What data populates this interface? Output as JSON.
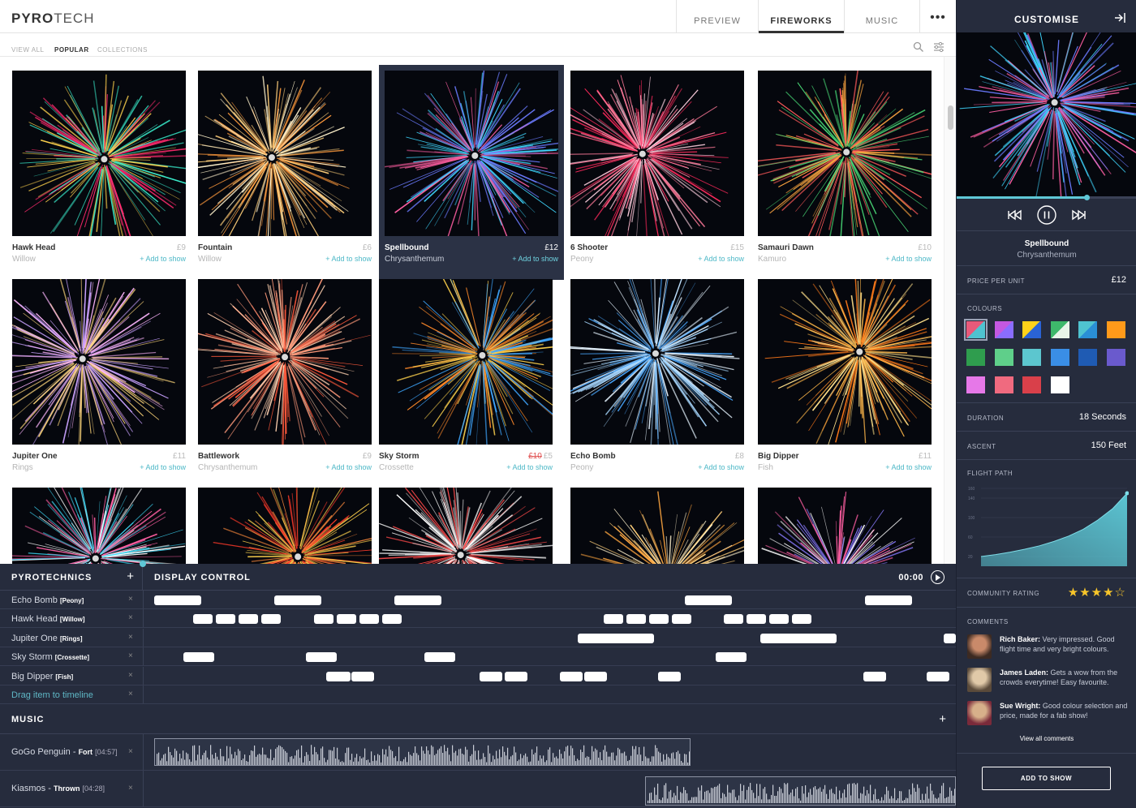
{
  "brand": {
    "bold": "PYRO",
    "light": "TECH"
  },
  "nav": {
    "tabs": [
      {
        "label": "PREVIEW",
        "active": false
      },
      {
        "label": "FIREWORKS",
        "active": true
      },
      {
        "label": "MUSIC",
        "active": false
      }
    ],
    "more_icon": "more-horizontal-icon"
  },
  "subnav": {
    "items": [
      {
        "label": "VIEW ALL",
        "active": false
      },
      {
        "label": "POPULAR",
        "active": true
      },
      {
        "label": "COLLECTIONS",
        "active": false
      }
    ],
    "icons": [
      "search-icon",
      "filter-icon"
    ]
  },
  "fireworks": [
    {
      "name": "Hawk Head",
      "type": "Willow",
      "price": "£9",
      "old_price": "",
      "add": "+ Add to show",
      "colors": [
        "#ff2a6d",
        "#38e8c8",
        "#ffd34d"
      ],
      "selected": false
    },
    {
      "name": "Fountain",
      "type": "Willow",
      "price": "£6",
      "old_price": "",
      "add": "+ Add to show",
      "colors": [
        "#ffcf7a",
        "#fff2cc",
        "#ff9a3c"
      ],
      "selected": false
    },
    {
      "name": "Spellbound",
      "type": "Chrysanthemum",
      "price": "£12",
      "old_price": "",
      "add": "+ Add to show",
      "colors": [
        "#3fd7ff",
        "#ff5fa2",
        "#6b7bff"
      ],
      "selected": true
    },
    {
      "name": "6 Shooter",
      "type": "Peony",
      "price": "£15",
      "old_price": "",
      "add": "+ Add to show",
      "colors": [
        "#ff2a5c",
        "#ff7a9a",
        "#ffd0e0"
      ],
      "selected": false
    },
    {
      "name": "Samauri Dawn",
      "type": "Kamuro",
      "price": "£10",
      "old_price": "",
      "add": "+ Add to show",
      "colors": [
        "#4be07a",
        "#ff5a5a",
        "#ffa640"
      ],
      "selected": false
    },
    {
      "name": "Jupiter One",
      "type": "Rings",
      "price": "£11",
      "old_price": "",
      "add": "+ Add to show",
      "colors": [
        "#ffb6ff",
        "#ffd77a",
        "#c9a2ff"
      ],
      "selected": false
    },
    {
      "name": "Battlework",
      "type": "Chrysanthemum",
      "price": "£9",
      "old_price": "",
      "add": "+ Add to show",
      "colors": [
        "#ff5a3c",
        "#ff9a7a",
        "#ffd1b0"
      ],
      "selected": false
    },
    {
      "name": "Sky Storm",
      "type": "Crossette",
      "price": "£5",
      "old_price": "£10",
      "add": "+ Add to show",
      "colors": [
        "#ff8a2a",
        "#ffd34d",
        "#3fa7ff"
      ],
      "selected": false
    },
    {
      "name": "Echo Bomb",
      "type": "Peony",
      "price": "£8",
      "old_price": "",
      "add": "+ Add to show",
      "colors": [
        "#4aa8ff",
        "#a8d8ff",
        "#e6f4ff"
      ],
      "selected": false
    },
    {
      "name": "Big Dipper",
      "type": "Fish",
      "price": "£11",
      "old_price": "",
      "add": "+ Add to show",
      "colors": [
        "#ff7a1a",
        "#ffb84a",
        "#ffe08a"
      ],
      "selected": false
    },
    {
      "name": "",
      "type": "",
      "price": "",
      "old_price": "",
      "add": "",
      "colors": [
        "#3fe0ff",
        "#ff5fa2",
        "#ffffff"
      ],
      "selected": false
    },
    {
      "name": "",
      "type": "",
      "price": "",
      "old_price": "",
      "add": "",
      "colors": [
        "#ff3a2a",
        "#ffd34d",
        "#ff8a3c"
      ],
      "selected": false
    },
    {
      "name": "",
      "type": "",
      "price": "",
      "old_price": "",
      "add": "",
      "colors": [
        "#ffffff",
        "#dcdcdc",
        "#ff4a4a"
      ],
      "selected": false
    },
    {
      "name": "",
      "type": "",
      "price": "",
      "old_price": "",
      "add": "",
      "colors": [
        "#ffcf7a",
        "#fff2cc",
        "#ffa640"
      ],
      "selected": false
    },
    {
      "name": "",
      "type": "",
      "price": "",
      "old_price": "",
      "add": "",
      "colors": [
        "#8a7bff",
        "#ff5fa2",
        "#ffffff"
      ],
      "selected": false
    }
  ],
  "pyrotechnics": {
    "title": "PYROTECHNICS",
    "add_icon": "plus-icon",
    "tracks": [
      {
        "name": "Echo Bomb",
        "type": "[Peony]"
      },
      {
        "name": "Hawk Head",
        "type": "[Willow]"
      },
      {
        "name": "Jupiter One",
        "type": "[Rings]"
      },
      {
        "name": "Sky Storm",
        "type": "[Crossette]"
      },
      {
        "name": "Big Dipper",
        "type": "[Fish]"
      }
    ],
    "drag_hint": "Drag item to timeline",
    "remove_glyph": "×"
  },
  "display_control": {
    "title": "DISPLAY CONTROL",
    "time": "00:00",
    "play_icon": "play-icon"
  },
  "music": {
    "title": "MUSIC",
    "tracks": [
      {
        "artist": "GoGo Penguin",
        "song": "Fort",
        "length": "[04:57]"
      },
      {
        "artist": "Kiasmos",
        "song": "Thrown",
        "length": "[04:28]"
      }
    ]
  },
  "customise": {
    "title": "CUSTOMISE",
    "collapse_icon": "collapse-right-icon",
    "preview_colors": [
      "#3fd7ff",
      "#ff5fa2",
      "#6b7bff"
    ],
    "playback_progress": 0.72,
    "controls": [
      "skip-back-icon",
      "pause-icon",
      "skip-forward-icon"
    ],
    "name": "Spellbound",
    "type": "Chrysanthemum",
    "price_label": "PRICE PER UNIT",
    "price": "£12",
    "colours_label": "COLOURS",
    "swatches": [
      [
        "#e85a7a",
        "#4fc3d0"
      ],
      [
        "#c458e0",
        "#8a6dff"
      ],
      [
        "#ffd21a",
        "#2a63d6"
      ],
      [
        "#3eb86b",
        "#e8f4e8"
      ],
      [
        "#4fc3d0",
        "#2a8fd6"
      ],
      [
        "#ff9a1a",
        "#ff9a1a"
      ],
      [
        "#2f9d4e",
        "#2f9d4e"
      ],
      [
        "#5fcf8a",
        "#5fcf8a"
      ],
      [
        "#5cc6cf",
        "#5cc6cf"
      ],
      [
        "#3a8ee6",
        "#3a8ee6"
      ],
      [
        "#1f5bb3",
        "#1f5bb3"
      ],
      [
        "#6a5acd",
        "#6a5acd"
      ],
      [
        "#e678e8",
        "#e678e8"
      ],
      [
        "#f06a7f",
        "#f06a7f"
      ],
      [
        "#d9404a",
        "#d9404a"
      ],
      [
        "#ffffff",
        "#ffffff"
      ]
    ],
    "selected_swatch": 0,
    "duration_label": "DURATION",
    "duration": "18 Seconds",
    "ascent_label": "ASCENT",
    "ascent": "150 Feet",
    "flight_label": "FLIGHT PATH",
    "rating_label": "COMMUNITY RATING",
    "rating": 4,
    "rating_max": 5,
    "comments_label": "COMMENTS",
    "comments": [
      {
        "author": "Rich Baker:",
        "text": "Very impressed. Good flight time and very bright colours."
      },
      {
        "author": "James Laden:",
        "text": "Gets a wow from the crowds everytime! Easy favourite."
      },
      {
        "author": "Sue Wright:",
        "text": "Good colour selection and price, made for a fab show!"
      }
    ],
    "view_all": "View all comments",
    "add_button": "ADD TO SHOW"
  },
  "chart_data": {
    "type": "area",
    "title": "FLIGHT PATH",
    "x": [
      0,
      1,
      2,
      3,
      4,
      5,
      6,
      7,
      8,
      9,
      10
    ],
    "values": [
      20,
      24,
      29,
      35,
      42,
      51,
      62,
      76,
      95,
      118,
      150
    ],
    "yticks": [
      20,
      60,
      100,
      140,
      160
    ],
    "ylim": [
      0,
      160
    ],
    "grid": true
  }
}
